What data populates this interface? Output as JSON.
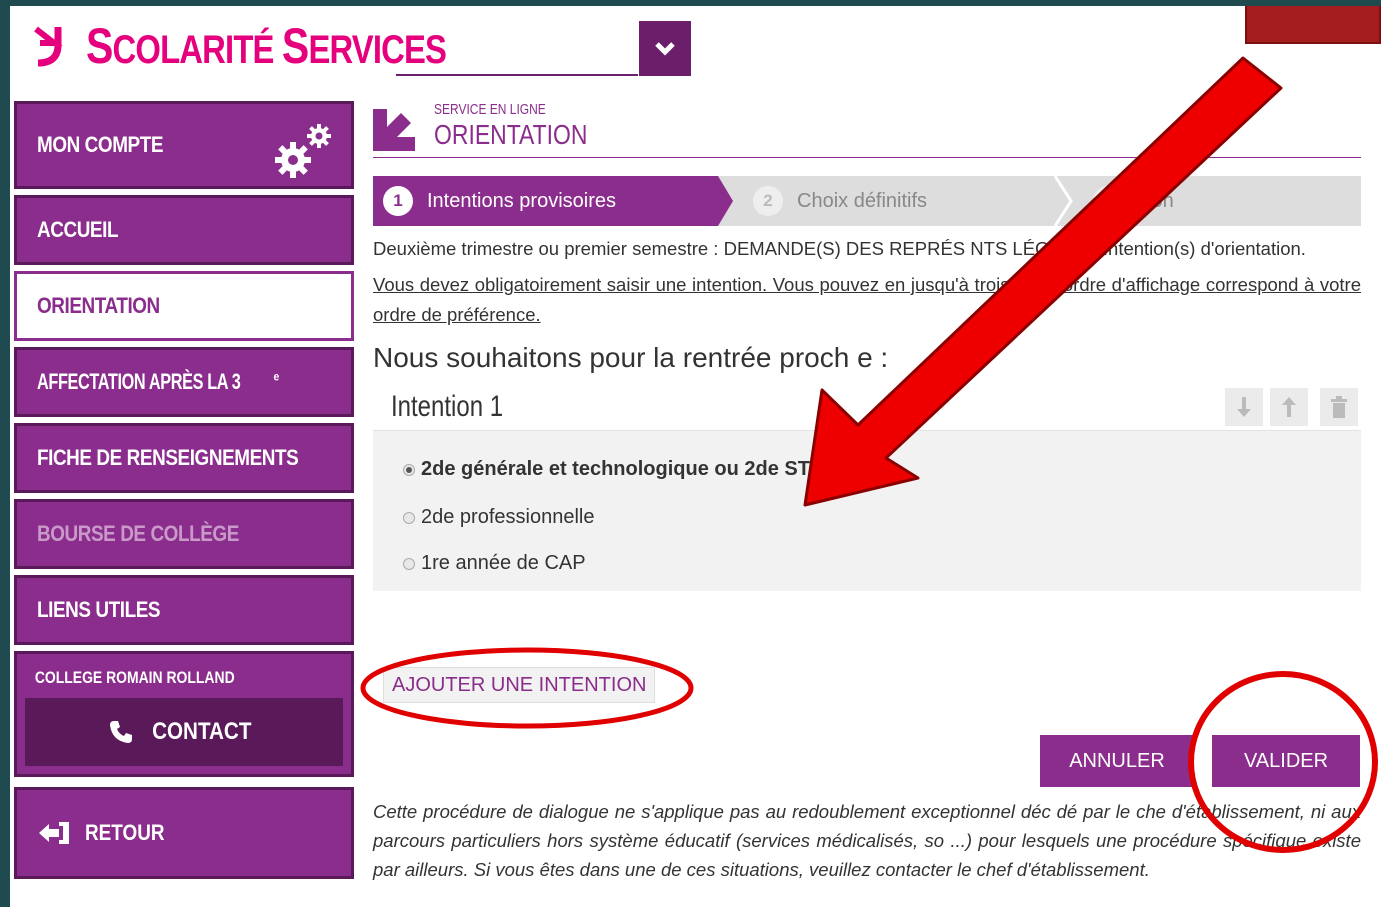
{
  "brand": {
    "name": "Scolarité Services",
    "name_first": "S",
    "name_rest1": "COLARITÉ ",
    "name_rest2": "S",
    "name_rest3": "ERVICES"
  },
  "sidebar": {
    "items": [
      {
        "label": "MON COMPTE"
      },
      {
        "label": "ACCUEIL"
      },
      {
        "label": "ORIENTATION"
      },
      {
        "label": "AFFECTATION APRÈS LA 3",
        "sup": "e"
      },
      {
        "label": "FICHE DE RENSEIGNEMENTS"
      },
      {
        "label": "BOURSE DE COLLÈGE"
      },
      {
        "label": "LIENS UTILES"
      }
    ],
    "college": "COLLEGE ROMAIN ROLLAND",
    "contact": "CONTACT",
    "retour": "RETOUR"
  },
  "header": {
    "service_small": "SERVICE EN LIGNE",
    "service_title": "ORIENTATION"
  },
  "steps": [
    {
      "num": "1",
      "label": "Intentions provisoires"
    },
    {
      "num": "2",
      "label": "Choix définitifs"
    },
    {
      "num": "3",
      "label": "sion"
    }
  ],
  "main": {
    "intro": "Deuxième trimestre ou premier semestre : DEMANDE(S) DES REPRÉS NTS LÉGAUX / Intention(s) d'orientation.",
    "instruction": "Vous devez obligatoirement saisir une intention. Vous pouvez en jusqu'à trois. Leur ordre d'affichage correspond à votre ordre de préférence.",
    "subtitle": "Nous souhaitons pour la rentrée proch e :",
    "intent_title": "Intention 1",
    "options": [
      "2de générale et technologique ou 2de STHR",
      "2de professionnelle",
      "1re année de CAP"
    ],
    "help": "?",
    "add_button": "AJOUTER UNE INTENTION",
    "cancel_button": "ANNULER",
    "validate_button": "VALIDER",
    "note": "Cette procédure de dialogue ne s'applique pas au redoublement exceptionnel déc dé par le che d'établissement, ni aux parcours particuliers hors système éducatif (services médicalisés, so ...) pour lesquels une procédure spécifique existe par ailleurs. Si vous êtes dans une de ces situations, veuillez contacter le chef d'établissement."
  },
  "colors": {
    "brand_pink": "#e5007d",
    "purple": "#8b2d8c",
    "dark_purple": "#5a1a5a",
    "annotation_red": "#e00000"
  },
  "icons": [
    "gear-icon",
    "chevron-down-icon",
    "phone-icon",
    "back-arrow-icon",
    "arrow-down-icon",
    "arrow-up-icon",
    "trash-icon",
    "help-icon",
    "logo-icon",
    "service-arrow-icon"
  ]
}
